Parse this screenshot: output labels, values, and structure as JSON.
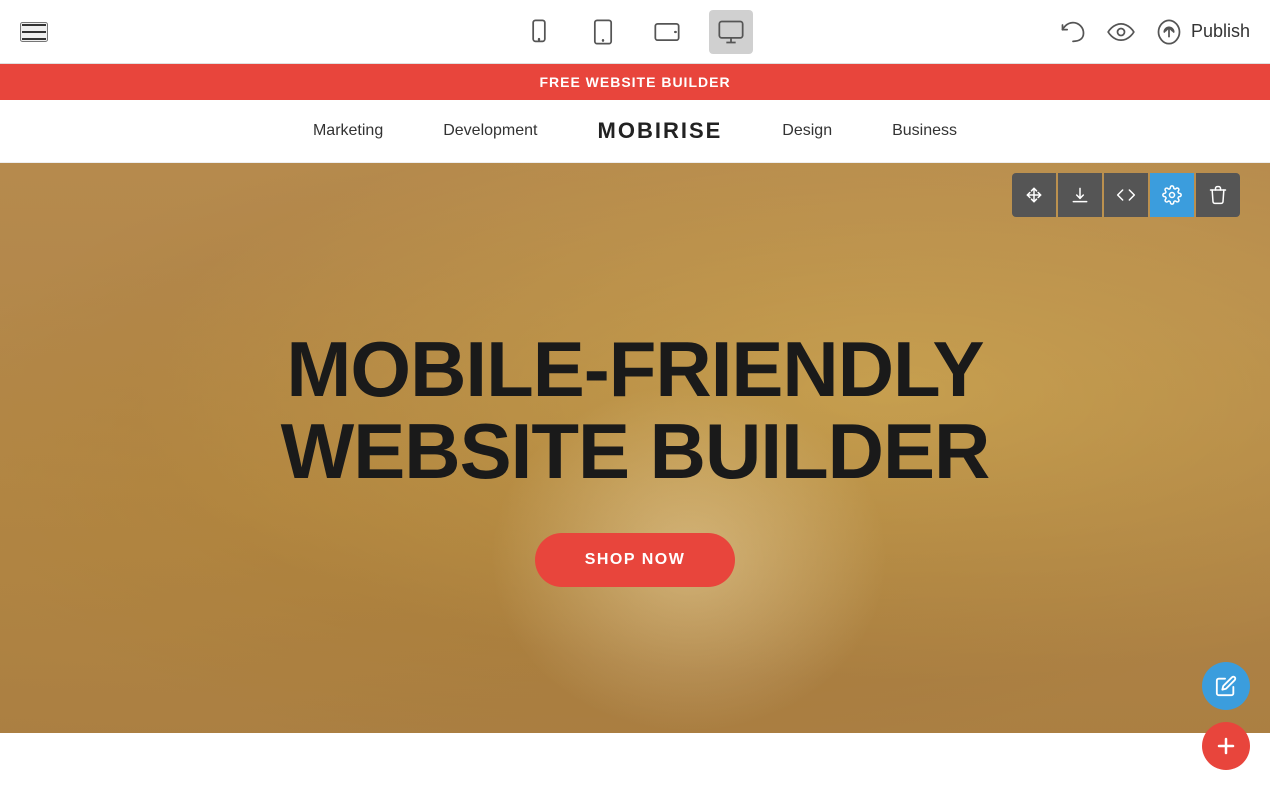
{
  "toolbar": {
    "publish_label": "Publish",
    "device_modes": [
      {
        "name": "mobile",
        "label": "Mobile view"
      },
      {
        "name": "tablet",
        "label": "Tablet view"
      },
      {
        "name": "tablet-landscape",
        "label": "Tablet landscape view"
      },
      {
        "name": "desktop",
        "label": "Desktop view"
      }
    ],
    "active_device": "desktop"
  },
  "promo_banner": {
    "text": "FREE WEBSITE BUILDER"
  },
  "site_nav": {
    "brand": "MOBIRISE",
    "items": [
      {
        "label": "Marketing"
      },
      {
        "label": "Development"
      },
      {
        "label": "Design"
      },
      {
        "label": "Business"
      }
    ]
  },
  "hero": {
    "title_line1": "MOBILE-FRIENDLY",
    "title_line2": "WEBSITE BUILDER",
    "cta_label": "SHOP NOW"
  },
  "section_toolbar": {
    "tools": [
      {
        "name": "move",
        "label": "Move"
      },
      {
        "name": "download",
        "label": "Download"
      },
      {
        "name": "code",
        "label": "Code"
      },
      {
        "name": "settings",
        "label": "Settings"
      },
      {
        "name": "delete",
        "label": "Delete"
      }
    ]
  },
  "floating": {
    "edit_label": "Edit",
    "add_label": "Add section"
  }
}
